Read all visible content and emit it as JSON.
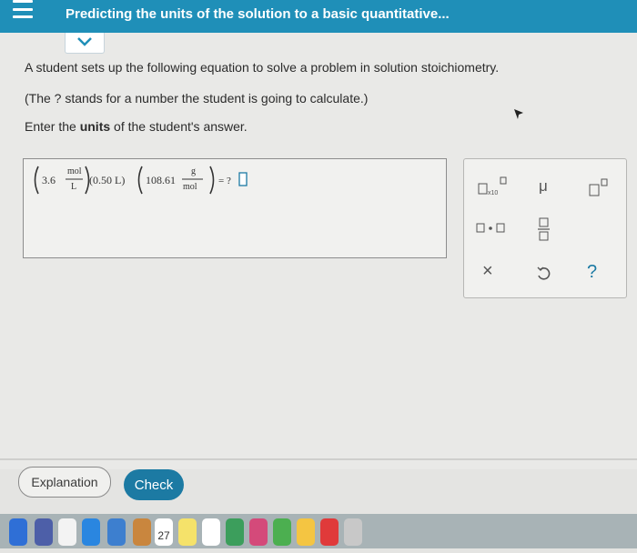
{
  "header": {
    "title": "Predicting the units of the solution to a basic quantitative..."
  },
  "question": {
    "line1": "A student sets up the following equation to solve a problem in solution stoichiometry.",
    "line2": "(The ? stands for a number the student is going to calculate.)",
    "line3_prefix": "Enter the ",
    "line3_bold": "units",
    "line3_suffix": " of the student's answer."
  },
  "equation": {
    "term1_value": "3.6",
    "term1_num": "mol",
    "term1_den": "L",
    "term2": "(0.50 L)",
    "term3_value": "108.61",
    "term3_num": "g",
    "term3_den": "mol",
    "equals": "= ?"
  },
  "tools": {
    "x10_label": "x10",
    "mu_label": "μ",
    "times_label": "×",
    "help_label": "?"
  },
  "buttons": {
    "explanation": "Explanation",
    "check": "Check"
  },
  "dock": {
    "calendar_day": "27"
  },
  "colors": {
    "header_bg": "#1f8fb8",
    "check_bg": "#1c7aa3",
    "help_color": "#1c7aa3"
  }
}
